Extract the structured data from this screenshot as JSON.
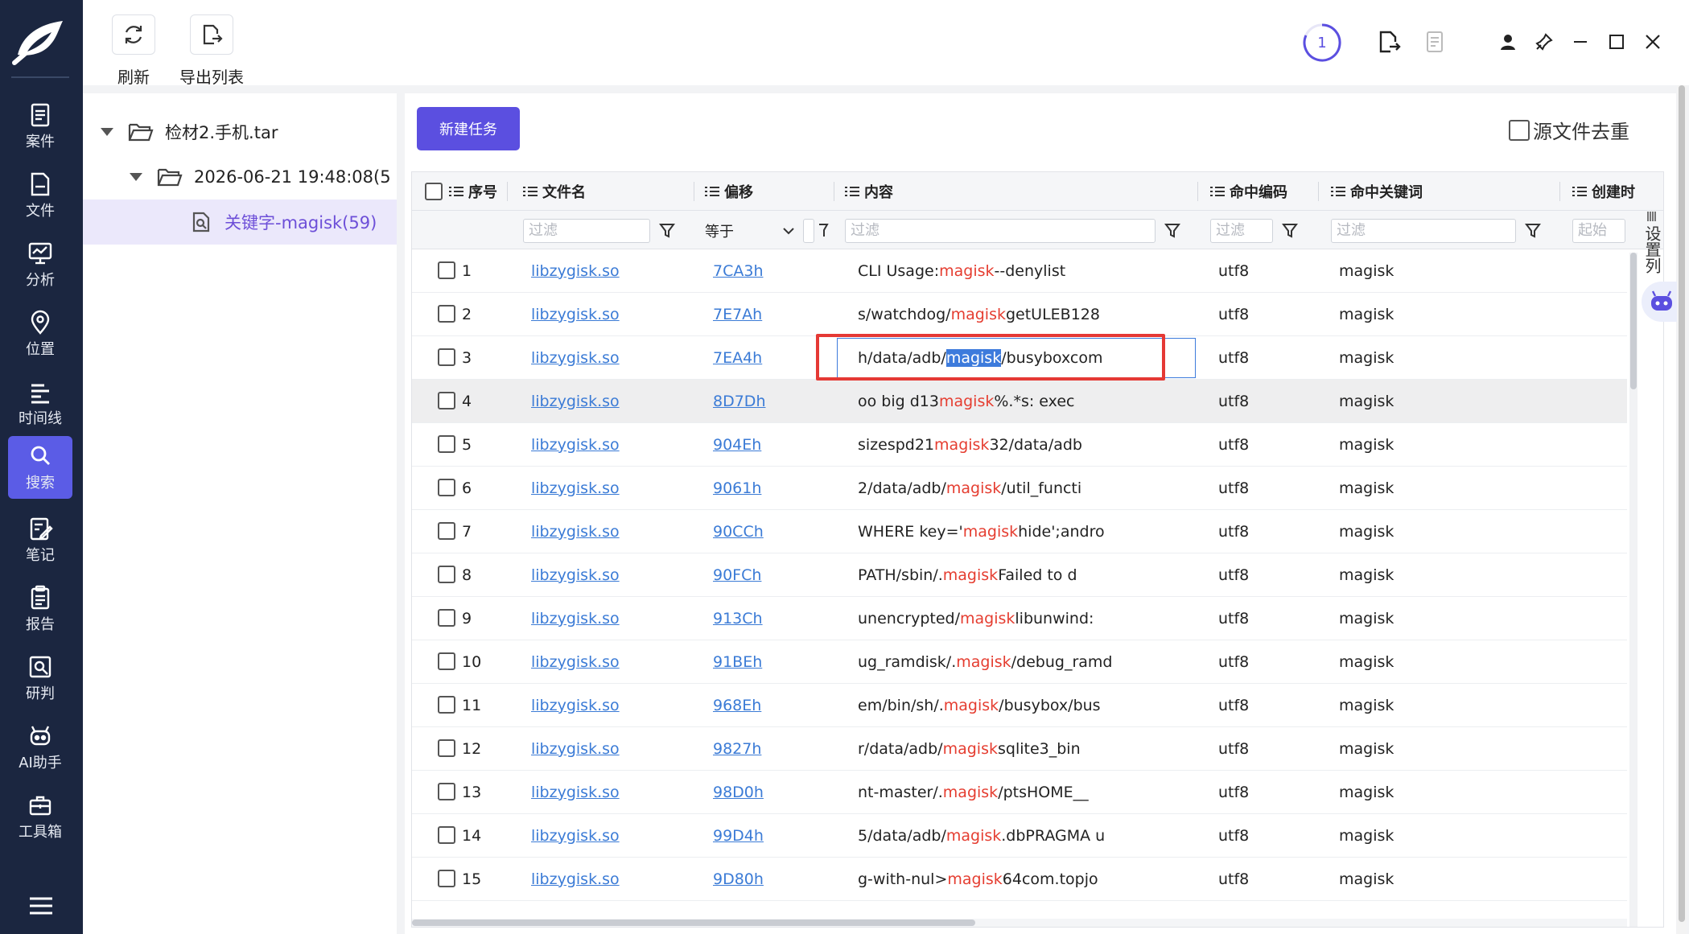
{
  "sidebar": {
    "items": [
      {
        "label": "案件",
        "icon": "case-icon"
      },
      {
        "label": "文件",
        "icon": "file-icon"
      },
      {
        "label": "分析",
        "icon": "analysis-icon"
      },
      {
        "label": "位置",
        "icon": "location-icon"
      },
      {
        "label": "时间线",
        "icon": "timeline-icon"
      },
      {
        "label": "搜索",
        "icon": "search-icon"
      },
      {
        "label": "笔记",
        "icon": "note-icon"
      },
      {
        "label": "报告",
        "icon": "report-icon"
      },
      {
        "label": "研判",
        "icon": "judge-icon"
      },
      {
        "label": "AI助手",
        "icon": "robot-icon"
      },
      {
        "label": "工具箱",
        "icon": "toolbox-icon"
      }
    ],
    "active_index": 5
  },
  "toolbar": {
    "refresh_label": "刷新",
    "export_label": "导出列表",
    "task_count": "1"
  },
  "tree": {
    "root_label": "检材2.手机.tar",
    "child_label": "2026-06-21 19:48:08(5",
    "leaf_label": "关键字-magisk(59)"
  },
  "main": {
    "new_task_label": "新建任务",
    "dedupe_label": "源文件去重",
    "column_settings_label": "设置列"
  },
  "grid": {
    "columns": {
      "index": "序号",
      "filename": "文件名",
      "offset": "偏移",
      "content": "内容",
      "encoding": "命中编码",
      "keyword": "命中关键词",
      "created": "创建时"
    },
    "filters": {
      "placeholder": "过滤",
      "offset_operator": "等于",
      "created_placeholder": "起始"
    },
    "rows": [
      {
        "index": "1",
        "filename": "libzygisk.so",
        "offset": "7CA3h",
        "pre": "CLI Usage: ",
        "kw": "magisk",
        "post": " --denylist",
        "encoding": "utf8",
        "keyword": "magisk"
      },
      {
        "index": "2",
        "filename": "libzygisk.so",
        "offset": "7E7Ah",
        "pre": "s/watchdog/",
        "kw": "magisk",
        "post": "getULEB128",
        "encoding": "utf8",
        "keyword": "magisk"
      },
      {
        "index": "3",
        "filename": "libzygisk.so",
        "offset": "7EA4h",
        "pre": "h/data/adb/",
        "kw": "magisk",
        "post": "/busyboxcom",
        "encoding": "utf8",
        "keyword": "magisk"
      },
      {
        "index": "4",
        "filename": "libzygisk.so",
        "offset": "8D7Dh",
        "pre": "oo big d13",
        "kw": "magisk",
        "post": "%.*s: exec",
        "encoding": "utf8",
        "keyword": "magisk"
      },
      {
        "index": "5",
        "filename": "libzygisk.so",
        "offset": "904Eh",
        "pre": "sizespd21",
        "kw": "magisk",
        "post": "32/data/adb",
        "encoding": "utf8",
        "keyword": "magisk"
      },
      {
        "index": "6",
        "filename": "libzygisk.so",
        "offset": "9061h",
        "pre": "2/data/adb/",
        "kw": "magisk",
        "post": "/util_functi",
        "encoding": "utf8",
        "keyword": "magisk"
      },
      {
        "index": "7",
        "filename": "libzygisk.so",
        "offset": "90CCh",
        "pre": "WHERE key='",
        "kw": "magisk",
        "post": "hide';andro",
        "encoding": "utf8",
        "keyword": "magisk"
      },
      {
        "index": "8",
        "filename": "libzygisk.so",
        "offset": "90FCh",
        "pre": "PATH/sbin/.",
        "kw": "magisk",
        "post": "Failed to d",
        "encoding": "utf8",
        "keyword": "magisk"
      },
      {
        "index": "9",
        "filename": "libzygisk.so",
        "offset": "913Ch",
        "pre": "unencrypted/",
        "kw": "magisk",
        "post": "libunwind:",
        "encoding": "utf8",
        "keyword": "magisk"
      },
      {
        "index": "10",
        "filename": "libzygisk.so",
        "offset": "91BEh",
        "pre": "ug_ramdisk/.",
        "kw": "magisk",
        "post": "/debug_ramd",
        "encoding": "utf8",
        "keyword": "magisk"
      },
      {
        "index": "11",
        "filename": "libzygisk.so",
        "offset": "968Eh",
        "pre": "em/bin/sh/.",
        "kw": "magisk",
        "post": "/busybox/bus",
        "encoding": "utf8",
        "keyword": "magisk"
      },
      {
        "index": "12",
        "filename": "libzygisk.so",
        "offset": "9827h",
        "pre": "r/data/adb/",
        "kw": "magisk",
        "post": "sqlite3_bin",
        "encoding": "utf8",
        "keyword": "magisk"
      },
      {
        "index": "13",
        "filename": "libzygisk.so",
        "offset": "98D0h",
        "pre": "nt-master/.",
        "kw": "magisk",
        "post": "/ptsHOME__",
        "encoding": "utf8",
        "keyword": "magisk"
      },
      {
        "index": "14",
        "filename": "libzygisk.so",
        "offset": "99D4h",
        "pre": "5/data/adb/",
        "kw": "magisk",
        "post": ".dbPRAGMA u",
        "encoding": "utf8",
        "keyword": "magisk"
      },
      {
        "index": "15",
        "filename": "libzygisk.so",
        "offset": "9D80h",
        "pre": "g-with-nul>",
        "kw": "magisk",
        "post": "64com.topjo",
        "encoding": "utf8",
        "keyword": "magisk"
      }
    ],
    "selected_row": 2,
    "hover_row": 3
  },
  "colors": {
    "sidebar_bg": "#1b2640",
    "accent": "#5b4fe0",
    "link": "#3b7bd6",
    "keyword_highlight": "#e53d30",
    "annotation_box": "#e53935"
  }
}
